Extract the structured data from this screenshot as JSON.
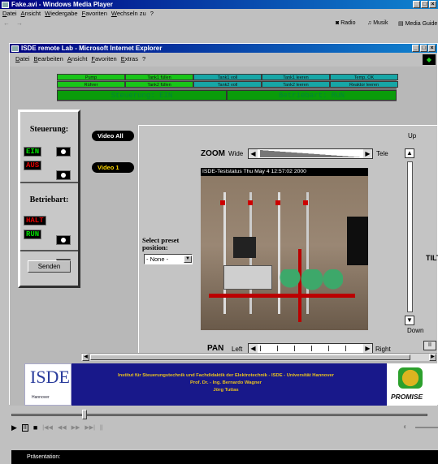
{
  "player": {
    "title": "Fake.avi - Windows Media Player",
    "menu": [
      "Datei",
      "Ansicht",
      "Wiedergabe",
      "Favoriten",
      "Wechseln zu",
      "?"
    ],
    "nav": [
      "←",
      "→"
    ],
    "links": [
      "Radio",
      "Musik",
      "Media Guide"
    ],
    "status_label": "Präsentation:"
  },
  "ie": {
    "title": "ISDE remote Lab - Microsoft Internet Explorer",
    "menu": [
      "Datei",
      "Bearbeiten",
      "Ansicht",
      "Favoriten",
      "Extras",
      "?"
    ]
  },
  "status_grid": {
    "row1": [
      {
        "label": "Pump",
        "color": "#19c519"
      },
      {
        "label": "Tank1 füllen",
        "color": "#19c519"
      },
      {
        "label": "Tank1 voll",
        "color": "#17a6a6"
      },
      {
        "label": "Tank1 leeren",
        "color": "#17a6a6"
      },
      {
        "label": "Temp. OK",
        "color": "#17a6a6"
      }
    ],
    "row2": [
      {
        "label": "Rührer",
        "color": "#19c519"
      },
      {
        "label": "Tank2 füllen",
        "color": "#19c519"
      },
      {
        "label": "Tank2 voll",
        "color": "#17a6a6"
      },
      {
        "label": "Tank2 leeren",
        "color": "#17a6a6"
      },
      {
        "label": "Reaktor leeren",
        "color": "#17a6a6"
      }
    ],
    "steuerung": "Steuerung: EIN",
    "betriebsart": "Betriebart: RUN"
  },
  "control": {
    "steuerung_h": "Steuerung:",
    "ein": "EIN",
    "aus": "AUS",
    "betriebsart_h": "Betriebart:",
    "halt": "HALT",
    "run": "RUN",
    "send": "Senden"
  },
  "video": {
    "all": "Video All",
    "v1": "Video 1"
  },
  "camera": {
    "zoom": "ZOOM",
    "wide": "Wide",
    "tele": "Tele",
    "caption": "ISDE-Teststatus Thu May  4 12:57:02 2000",
    "preset_label": "Select preset position:",
    "preset_value": "- None -",
    "up": "Up",
    "down": "Down",
    "tilt": "TILT",
    "pan": "PAN",
    "left": "Left",
    "right": "Right"
  },
  "footer": {
    "logo": "ISDE",
    "sublogo": "Hannover",
    "line1": "Institut für Steuerungstechnik und Fachdidaktik der Elektrotechnik - ISDE - Universität Hannover",
    "line2": "Prof. Dr. - Ing. Bernardo Wagner",
    "line3": "Jörg Tuttas",
    "promise": "PROMISE"
  }
}
